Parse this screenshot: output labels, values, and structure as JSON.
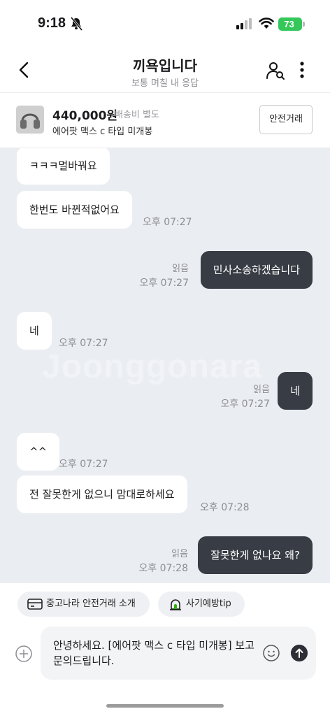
{
  "status": {
    "time": "9:18",
    "battery": "73"
  },
  "header": {
    "title": "끼욕입니다",
    "subtitle": "보통 며칠 내 응답"
  },
  "product": {
    "price": "440,000원",
    "shipping": "배송비 별도",
    "name": "에어팟 맥스 c 타입 미개봉",
    "safe_button": "안전거래"
  },
  "watermark": "Joonggonara",
  "messages": [
    {
      "dir": "in",
      "text": "ㅋㅋㅋ멀바꿔요"
    },
    {
      "dir": "in",
      "text": "한번도 바뀐적없어요",
      "time": "오후 07:27"
    },
    {
      "dir": "out",
      "text": "민사소송하겠습니다",
      "read": "읽음",
      "time": "오후 07:27"
    },
    {
      "dir": "in",
      "text": "네",
      "time": "오후 07:27"
    },
    {
      "dir": "out",
      "text": "네",
      "read": "읽음",
      "time": "오후 07:27"
    },
    {
      "dir": "in",
      "text": "^^",
      "time": "오후 07:27"
    },
    {
      "dir": "in",
      "text": "전 잘못한게 없으니 맘대로하세요",
      "time": "오후 07:28"
    },
    {
      "dir": "out",
      "text": "잘못한게 없나요 왜?",
      "read": "읽음",
      "time": "오후 07:28"
    }
  ],
  "chips": [
    {
      "label": "중고나라 안전거래 소개",
      "icon": "card-icon"
    },
    {
      "label": "사기예방tip",
      "icon": "siren-icon"
    }
  ],
  "input": {
    "value": "안녕하세요. [에어팟 맥스 c 타입 미개봉] 보고 문의드립니다."
  },
  "colors": {
    "chat_bg": "#eaedf1",
    "out_bubble": "#383c44",
    "battery": "#34c759"
  }
}
